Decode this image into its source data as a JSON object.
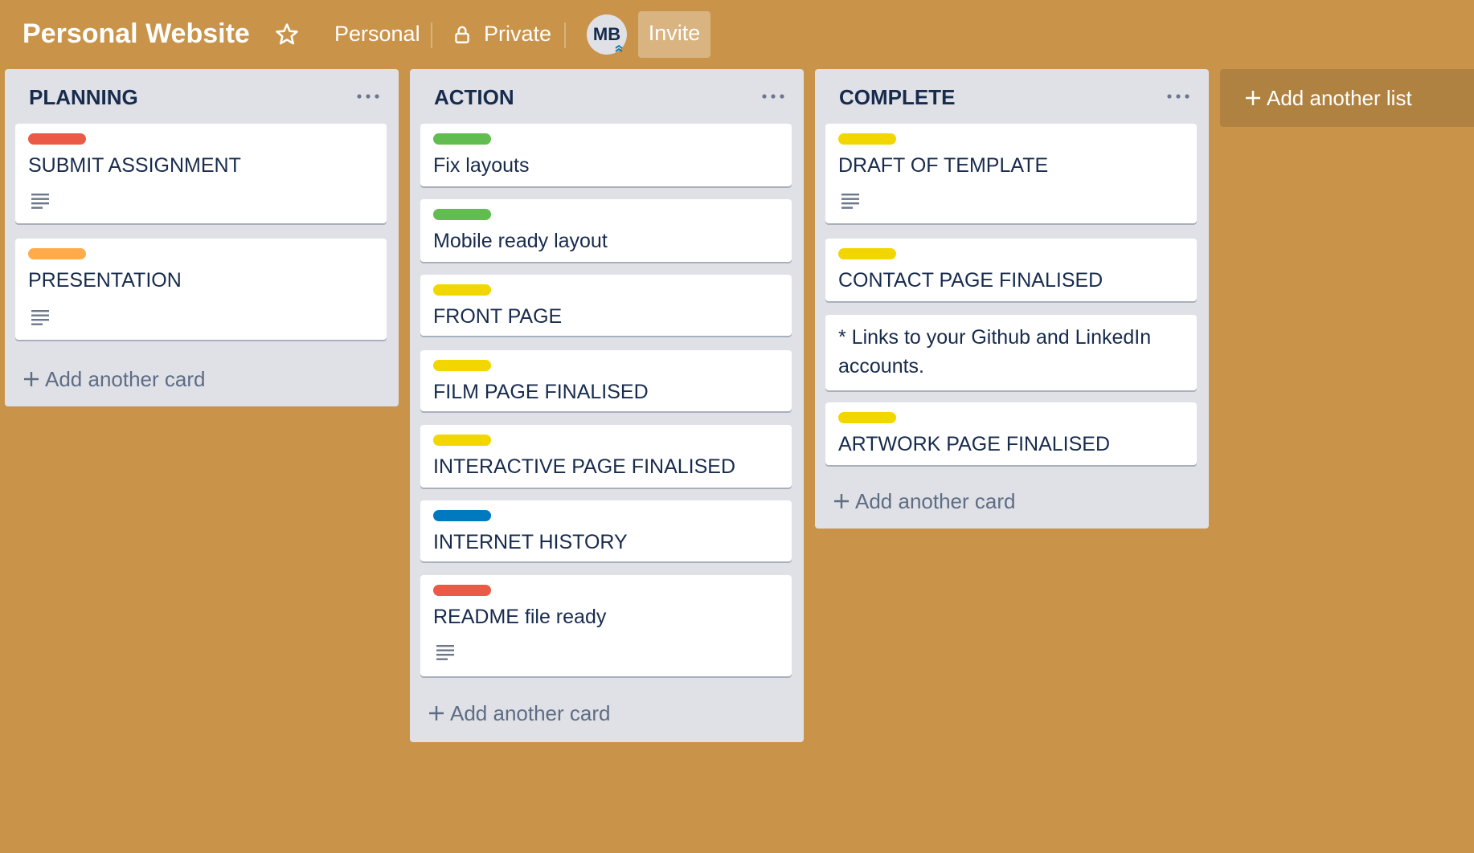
{
  "board": {
    "title": "Personal Website",
    "team": "Personal",
    "visibility": "Private",
    "member_initials": "MB",
    "invite_label": "Invite",
    "background_color": "#C9944A"
  },
  "label_colors": {
    "red": "#EB5A46",
    "orange": "#FFAB4A",
    "green": "#61BD4F",
    "yellow": "#F2D600",
    "blue": "#0079BF"
  },
  "lists": [
    {
      "title": "PLANNING",
      "cards": [
        {
          "label": "red",
          "title": "SUBMIT ASSIGNMENT",
          "has_description": true
        },
        {
          "label": "orange",
          "title": "PRESENTATION",
          "has_description": true
        }
      ],
      "add_card_label": "Add another card"
    },
    {
      "title": "ACTION",
      "cards": [
        {
          "label": "green",
          "title": "Fix layouts",
          "has_description": false
        },
        {
          "label": "green",
          "title": "Mobile ready layout",
          "has_description": false
        },
        {
          "label": "yellow",
          "title": "FRONT PAGE",
          "has_description": false
        },
        {
          "label": "yellow",
          "title": "FILM PAGE FINALISED",
          "has_description": false
        },
        {
          "label": "yellow",
          "title": "INTERACTIVE PAGE FINALISED",
          "has_description": false
        },
        {
          "label": "blue",
          "title": "INTERNET HISTORY",
          "has_description": false
        },
        {
          "label": "red",
          "title": "README file ready",
          "has_description": true
        }
      ],
      "add_card_label": "Add another card"
    },
    {
      "title": "COMPLETE",
      "cards": [
        {
          "label": "yellow",
          "title": "DRAFT OF TEMPLATE",
          "has_description": true
        },
        {
          "label": "yellow",
          "title": "CONTACT PAGE FINALISED",
          "has_description": false
        },
        {
          "label": null,
          "title": "* Links to your Github and LinkedIn accounts.",
          "has_description": false
        },
        {
          "label": "yellow",
          "title": "ARTWORK PAGE FINALISED",
          "has_description": false
        }
      ],
      "add_card_label": "Add another card"
    }
  ],
  "add_list_label": "Add another list",
  "icons": {
    "star": "star-icon",
    "lock": "lock-icon",
    "menu": "more-horizontal-icon",
    "description": "description-lines-icon",
    "plus": "plus-icon",
    "admin_badge": "chevron-up-double-icon"
  }
}
